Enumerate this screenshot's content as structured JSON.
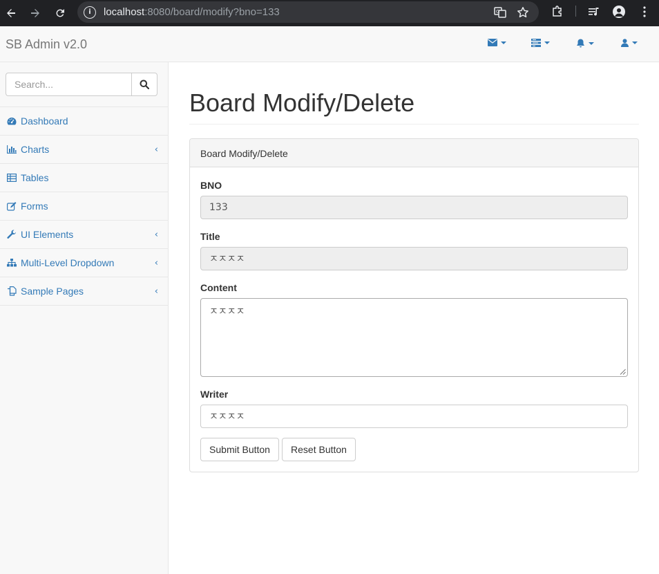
{
  "browser": {
    "url_host": "localhost",
    "url_path": ":8080/board/modify?bno=133"
  },
  "navbar": {
    "brand": "SB Admin v2.0"
  },
  "sidebar": {
    "search_placeholder": "Search...",
    "items": [
      {
        "label": "Dashboard",
        "icon": "dashboard-icon",
        "has_submenu": false
      },
      {
        "label": "Charts",
        "icon": "bar-chart-icon",
        "has_submenu": true
      },
      {
        "label": "Tables",
        "icon": "table-icon",
        "has_submenu": false
      },
      {
        "label": "Forms",
        "icon": "edit-icon",
        "has_submenu": false
      },
      {
        "label": "UI Elements",
        "icon": "wrench-icon",
        "has_submenu": true
      },
      {
        "label": "Multi-Level Dropdown",
        "icon": "sitemap-icon",
        "has_submenu": true
      },
      {
        "label": "Sample Pages",
        "icon": "files-icon",
        "has_submenu": true
      }
    ]
  },
  "page": {
    "title": "Board Modify/Delete",
    "panel_heading": "Board Modify/Delete",
    "form": {
      "bno_label": "BNO",
      "bno_value": "133",
      "title_label": "Title",
      "title_value": "ㅈㅈㅈㅈ",
      "content_label": "Content",
      "content_value": "ㅈㅈㅈㅈ",
      "writer_label": "Writer",
      "writer_value": "ㅈㅈㅈㅈ"
    },
    "buttons": {
      "submit": "Submit Button",
      "reset": "Reset Button"
    }
  },
  "colors": {
    "link": "#337ab7",
    "browser_bg": "#202124"
  }
}
